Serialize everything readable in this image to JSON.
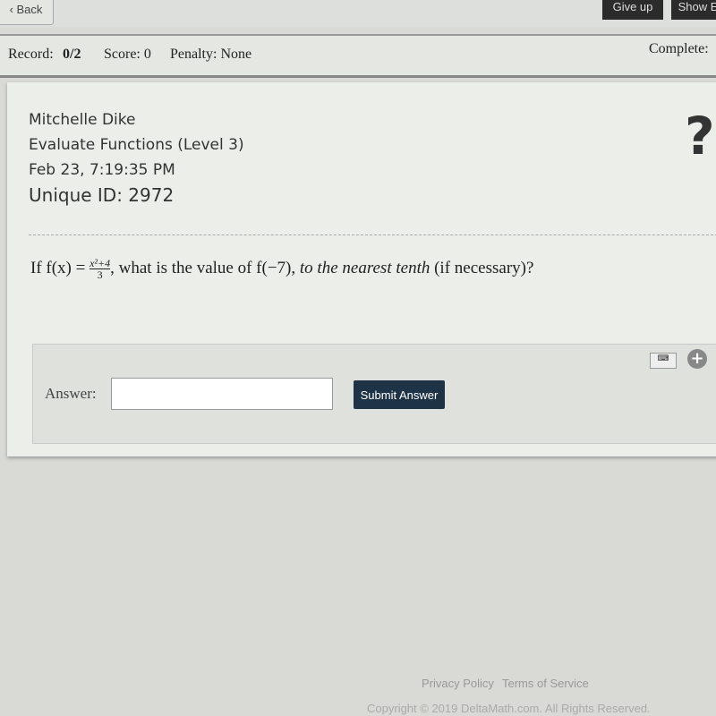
{
  "nav": {
    "back": "Back",
    "give_up": "Give up",
    "show": "Show E"
  },
  "record": {
    "record_label": "Record:",
    "record_value": "0/2",
    "score": "Score: 0",
    "penalty": "Penalty: None",
    "complete": "Complete:"
  },
  "problem": {
    "student": "Mitchelle Dike",
    "topic": "Evaluate Functions (Level 3)",
    "date": "Feb 23, 7:19:35 PM",
    "unique_id": "Unique ID: 2972",
    "help_icon": "?",
    "q_pre": "If f(x) = ",
    "numerator": "x²+4",
    "denominator": "3",
    "q_mid": ", what is the value of f(−7), ",
    "q_italic": "to the nearest tenth",
    "q_post": " (if necessary)?"
  },
  "answer": {
    "label": "Answer:",
    "value": "",
    "submit": "Submit Answer"
  },
  "footer": {
    "privacy": "Privacy Policy",
    "terms": "Terms of Service",
    "copyright": "Copyright © 2019 DeltaMath.com. All Rights Reserved."
  }
}
